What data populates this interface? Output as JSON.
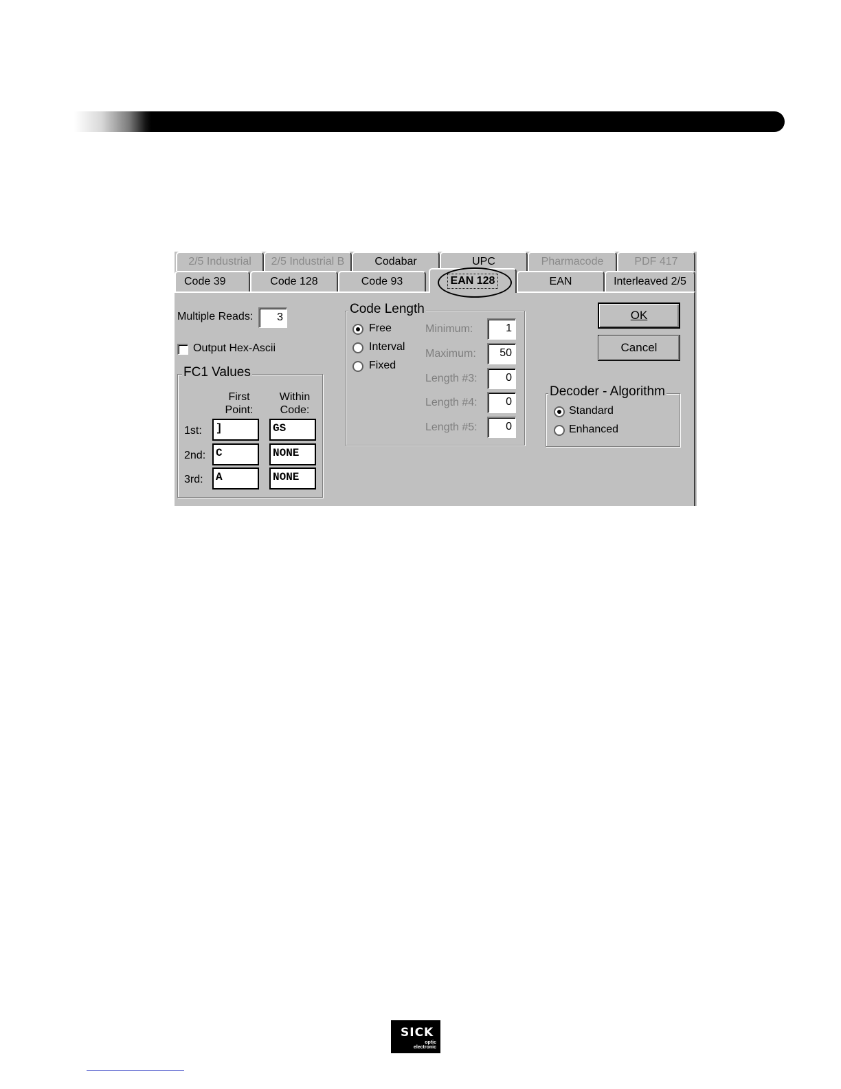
{
  "tabs_back": [
    {
      "label": "2/5 Industrial",
      "enabled": false
    },
    {
      "label": "2/5 Industrial B",
      "enabled": false
    },
    {
      "label": "Codabar",
      "enabled": true
    },
    {
      "label": "UPC",
      "enabled": true
    },
    {
      "label": "Pharmacode",
      "enabled": false
    },
    {
      "label": "PDF 417",
      "enabled": false
    }
  ],
  "tabs_front": [
    {
      "label": "Code 39"
    },
    {
      "label": "Code 128"
    },
    {
      "label": "Code 93"
    },
    {
      "label": "EAN 128",
      "active": true
    },
    {
      "label": "EAN"
    },
    {
      "label": "Interleaved 2/5"
    }
  ],
  "multiple_reads": {
    "label": "Multiple Reads:",
    "value": "3"
  },
  "output_hex": {
    "label": "Output Hex-Ascii",
    "checked": false
  },
  "fc1": {
    "title": "FC1 Values",
    "col1_line1": "First",
    "col1_line2": "Point:",
    "col2_line1": "Within",
    "col2_line2": "Code:",
    "rows": [
      {
        "label": "1st:",
        "first": "]",
        "within": "GS"
      },
      {
        "label": "2nd:",
        "first": "C",
        "within": "NONE"
      },
      {
        "label": "3rd:",
        "first": "A",
        "within": "NONE"
      }
    ]
  },
  "code_length": {
    "title": "Code Length",
    "options": [
      {
        "label": "Free",
        "selected": true
      },
      {
        "label": "Interval",
        "selected": false
      },
      {
        "label": "Fixed",
        "selected": false
      }
    ],
    "fields": [
      {
        "label": "Minimum:",
        "value": "1"
      },
      {
        "label": "Maximum:",
        "value": "50"
      },
      {
        "label": "Length #3:",
        "value": "0"
      },
      {
        "label": "Length #4:",
        "value": "0"
      },
      {
        "label": "Length #5:",
        "value": "0"
      }
    ]
  },
  "buttons": {
    "ok": "OK",
    "cancel": "Cancel"
  },
  "decoder": {
    "title": "Decoder - Algorithm",
    "options": [
      {
        "label": "Standard",
        "selected": true
      },
      {
        "label": "Enhanced",
        "selected": false
      }
    ]
  },
  "logo": {
    "name": "SICK",
    "line1": "optic",
    "line2": "electronic"
  }
}
